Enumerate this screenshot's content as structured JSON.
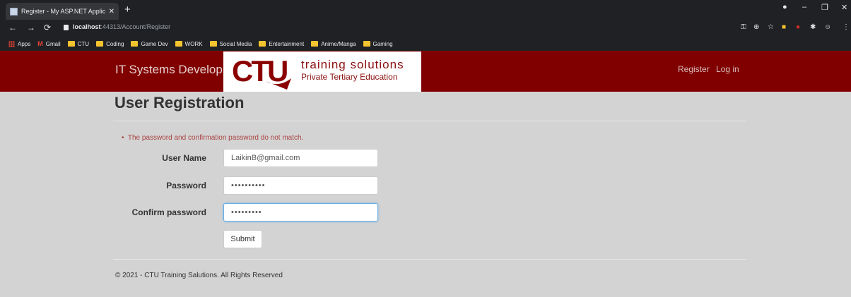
{
  "browser": {
    "tab_title": "Register - My ASP.NET Applicatio",
    "tab_close": "✕",
    "new_tab": "+",
    "url_host": "localhost",
    "url_path": ":44313/Account/Register",
    "bookmarks": [
      "Apps",
      "Gmail",
      "CTU",
      "Coding",
      "Game Dev",
      "WORK",
      "Social Media",
      "Entertainment",
      "Anime/Manga",
      "Gaming"
    ]
  },
  "navbar": {
    "brand": "IT Systems Development",
    "logo_text": "CTU",
    "logo_tagline": "training solutions",
    "logo_subtagline": "Private Tertiary Education",
    "register_link": "Register",
    "login_link": "Log in",
    "background_color": "#800000"
  },
  "form": {
    "title": "User Registration",
    "error": "The password and confirmation password do not match.",
    "username_label": "User Name",
    "username_value": "LaikinB@gmail.com",
    "password_label": "Password",
    "password_value": "••••••••••",
    "confirm_label": "Confirm password",
    "confirm_value": "•••••••••",
    "submit_label": "Submit"
  },
  "footer": {
    "text": "© 2021 - CTU Training Salutions. All Rights Reserved"
  }
}
